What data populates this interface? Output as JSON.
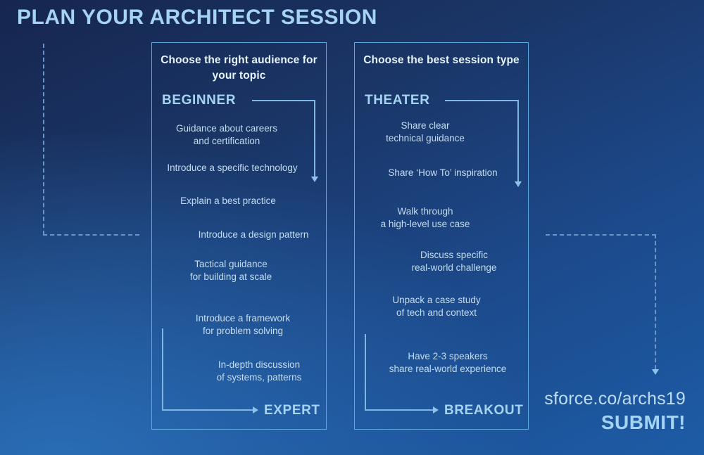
{
  "page": {
    "title": "Plan your architect session",
    "background_top_color": "#16264f",
    "background_bottom_color": "#1d5ca6",
    "accent_color": "#a5d4f2",
    "line_color": "#7fb6e2",
    "body_text_color": "#c3dcf0"
  },
  "panels": [
    {
      "id": "audience",
      "header": "Choose the right audience\nfor your topic",
      "start_label": "BEGINNER",
      "end_label": "EXPERT",
      "items": [
        "Guidance about careers\nand certification",
        "Introduce a specific technology",
        "Explain a best practice",
        "Introduce a design pattern",
        "Tactical guidance\nfor building at scale",
        "Introduce a framework\nfor problem solving",
        "In-depth discussion\nof systems, patterns"
      ]
    },
    {
      "id": "session-type",
      "header": "Choose the best session type",
      "start_label": "THEATER",
      "end_label": "BREAKOUT",
      "items": [
        "Share clear\ntechnical guidance",
        "Share ‘How To’ inspiration",
        "Walk through\na high-level use case",
        "Discuss specific\nreal-world challenge",
        "Unpack a case study\nof tech and context",
        "Have 2-3 speakers\nshare real-world experience"
      ]
    }
  ],
  "cta": {
    "url": "sforce.co/archs19",
    "submit": "SUBMIT!"
  }
}
